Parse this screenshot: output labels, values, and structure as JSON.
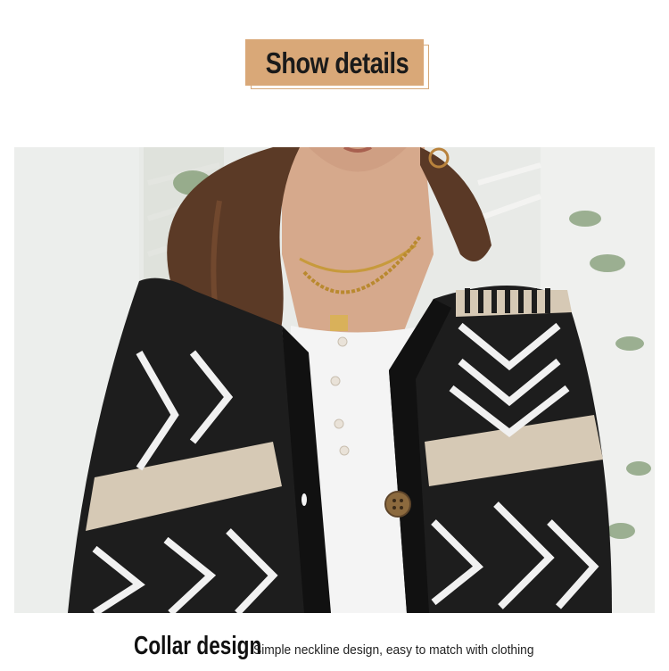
{
  "header": {
    "badge_title": "Show details",
    "badge_color": "#d9a878"
  },
  "photo": {
    "alt_subject": "woman wearing black geometric pattern cardigan with gold necklaces over white henley top",
    "sweater_colors": [
      "#1c1c1c",
      "#d8cbb8",
      "#f2f2f2"
    ]
  },
  "caption": {
    "title": "Collar design",
    "description": "Simple neckline design, easy to match with clothing"
  }
}
